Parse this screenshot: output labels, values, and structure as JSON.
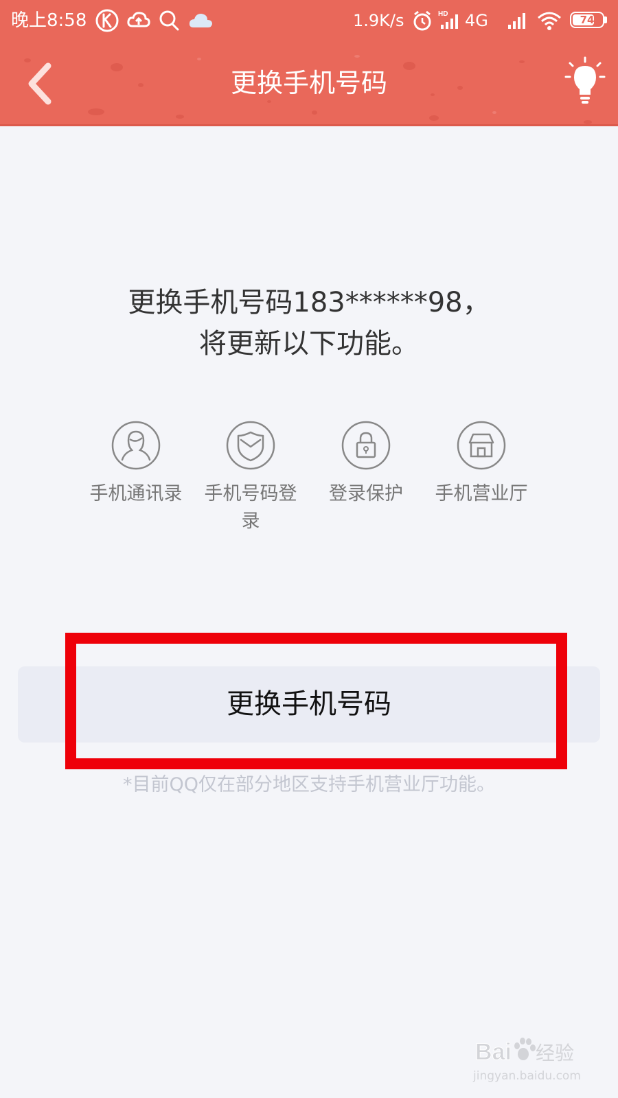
{
  "status_bar": {
    "time": "晚上8:58",
    "network_speed": "1.9K/s",
    "network_type": "4G",
    "battery_level": "74",
    "battery_fraction": 0.74,
    "icons": [
      "k-app-icon",
      "cloud-upload-icon",
      "search-icon",
      "weather-cloud-icon",
      "alarm-icon",
      "hd-signal-icon",
      "signal-icon",
      "wifi-icon",
      "battery-icon"
    ]
  },
  "header": {
    "title": "更换手机号码",
    "back_icon": "chevron-left-icon",
    "right_icon": "lightbulb-icon"
  },
  "main": {
    "headline_line1": "更换手机号码183******98，",
    "headline_line2": "将更新以下功能。",
    "features": [
      {
        "label": "手机通讯录",
        "icon": "contact-person-icon"
      },
      {
        "label": "手机号码登\n录",
        "icon": "shield-icon"
      },
      {
        "label": "登录保护",
        "icon": "lock-icon"
      },
      {
        "label": "手机营业厅",
        "icon": "store-icon"
      }
    ],
    "button_label": "更换手机号码",
    "footnote": "*目前QQ仅在部分地区支持手机营业厅功能。"
  },
  "annotation": {
    "highlight_color": "#ee0009"
  },
  "watermark": {
    "logo_text": "Bai 经验",
    "url": "jingyan.baidu.com"
  },
  "colors": {
    "accent": "#e9685a",
    "background": "#f4f5f9",
    "button_bg": "#eaecf4"
  }
}
